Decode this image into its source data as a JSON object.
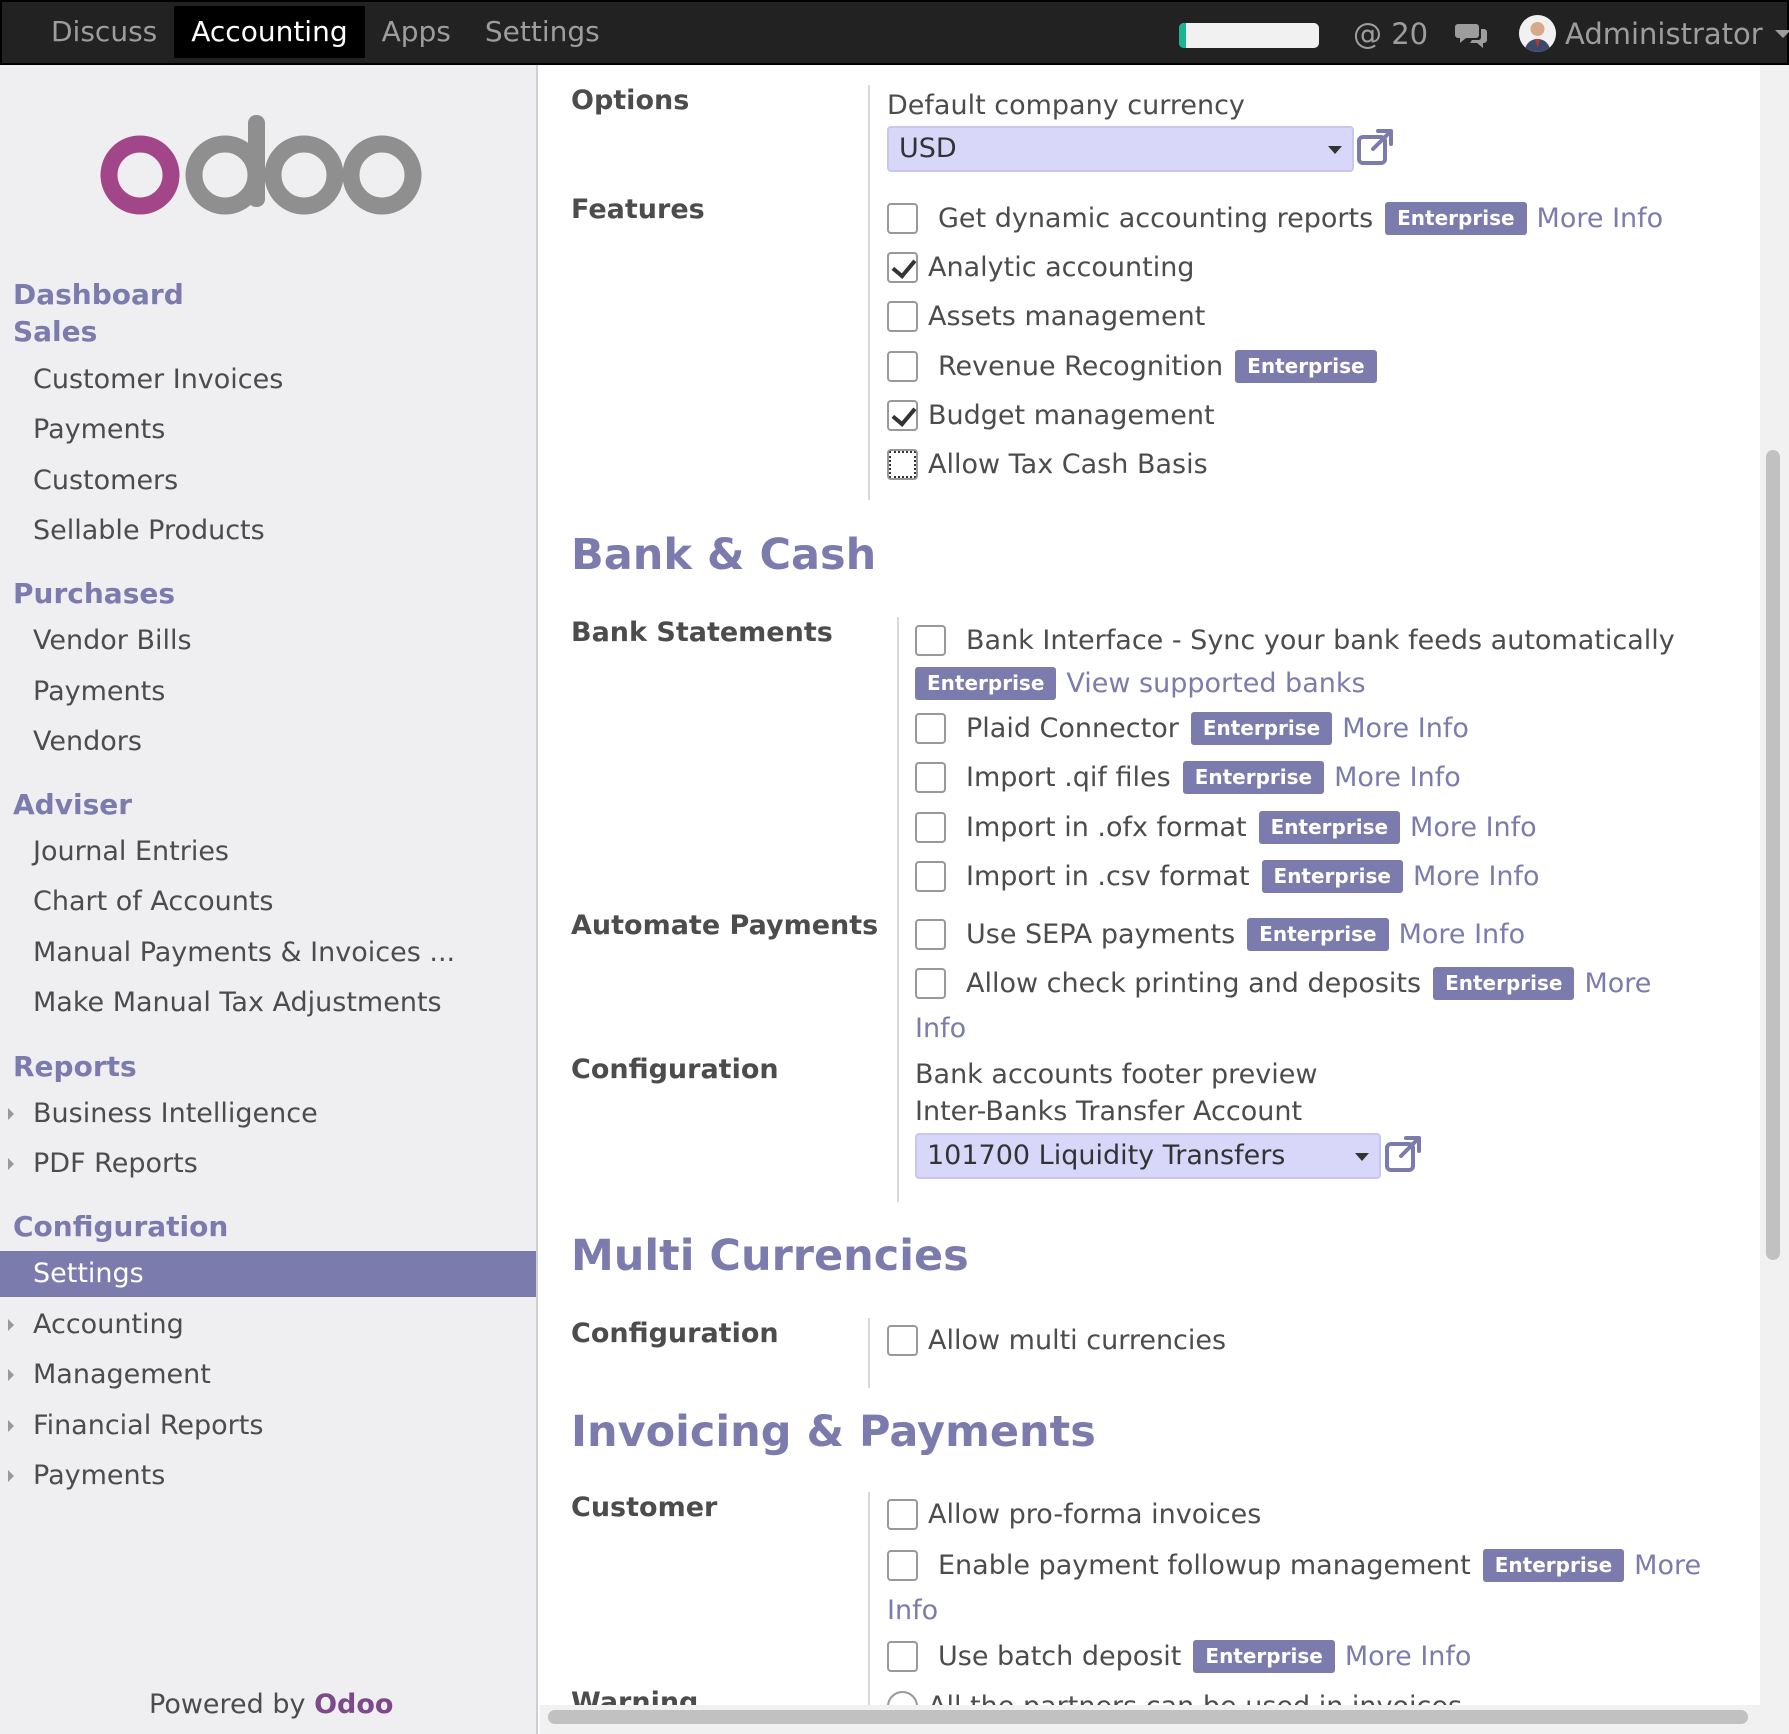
{
  "topbar": {
    "menu": [
      "Discuss",
      "Accounting",
      "Apps",
      "Settings"
    ],
    "active_menu": "Accounting",
    "progress_fraction": 0.05,
    "mentions": "@ 20",
    "user": "Administrator"
  },
  "sidebar": {
    "logo": "odoo",
    "groups": {
      "dashboard": "Dashboard",
      "sales": "Sales",
      "purchases": "Purchases",
      "adviser": "Adviser",
      "reports": "Reports",
      "configuration": "Configuration"
    },
    "sales_items": [
      "Customer Invoices",
      "Payments",
      "Customers",
      "Sellable Products"
    ],
    "purchases_items": [
      "Vendor Bills",
      "Payments",
      "Vendors"
    ],
    "adviser_items": [
      "Journal Entries",
      "Chart of Accounts",
      "Manual Payments & Invoices ...",
      "Make Manual Tax Adjustments"
    ],
    "reports_items": [
      "Business Intelligence",
      "PDF Reports"
    ],
    "configuration_items": [
      "Settings",
      "Accounting",
      "Management",
      "Financial Reports",
      "Payments"
    ],
    "active_item": "Settings",
    "powered_by": "Powered by",
    "powered_brand": "Odoo"
  },
  "settings": {
    "options_label": "Options",
    "currency_label": "Default company currency",
    "currency_value": "USD",
    "features_label": "Features",
    "features": [
      {
        "label": "Get dynamic accounting reports",
        "checked": false,
        "enterprise": true,
        "more_info": "More Info"
      },
      {
        "label": "Analytic accounting",
        "checked": true
      },
      {
        "label": "Assets management",
        "checked": false
      },
      {
        "label": "Revenue Recognition",
        "checked": false,
        "enterprise": true
      },
      {
        "label": "Budget management",
        "checked": true
      },
      {
        "label": "Allow Tax Cash Basis",
        "checked": false
      }
    ],
    "bank_cash_title": "Bank & Cash",
    "bank_statements_label": "Bank Statements",
    "bank_statements": [
      {
        "label": "Bank Interface - Sync your bank feeds automatically",
        "enterprise": true,
        "link": "View supported banks"
      },
      {
        "label": "Plaid Connector",
        "enterprise": true,
        "link": "More Info"
      },
      {
        "label": "Import .qif files",
        "enterprise": true,
        "link": "More Info"
      },
      {
        "label": "Import in .ofx format",
        "enterprise": true,
        "link": "More Info"
      },
      {
        "label": "Import in .csv format",
        "enterprise": true,
        "link": "More Info"
      }
    ],
    "automate_payments_label": "Automate Payments",
    "automate_payments": [
      {
        "label": "Use SEPA payments",
        "enterprise": true,
        "link": "More Info"
      },
      {
        "label": "Allow check printing and deposits",
        "enterprise": true,
        "link_a": "More",
        "link_b": "Info"
      }
    ],
    "bank_config_label": "Configuration",
    "footer_preview": "Bank accounts footer preview",
    "transfer_account_label": "Inter-Banks Transfer Account",
    "transfer_account_value": "101700 Liquidity Transfers",
    "multi_currencies_title": "Multi Currencies",
    "multi_config_label": "Configuration",
    "multi_currency_option": "Allow multi currencies",
    "invoicing_title": "Invoicing & Payments",
    "customer_label": "Customer",
    "customer_options": [
      {
        "label": "Allow pro-forma invoices"
      },
      {
        "label": "Enable payment followup management",
        "enterprise": true,
        "link_a": "More",
        "link_b": "Info"
      },
      {
        "label": "Use batch deposit",
        "enterprise": true,
        "link": "More Info"
      }
    ],
    "warning_label": "Warning",
    "warning_option": "All the partners can be used in invoices",
    "enterprise_badge": "Enterprise"
  }
}
